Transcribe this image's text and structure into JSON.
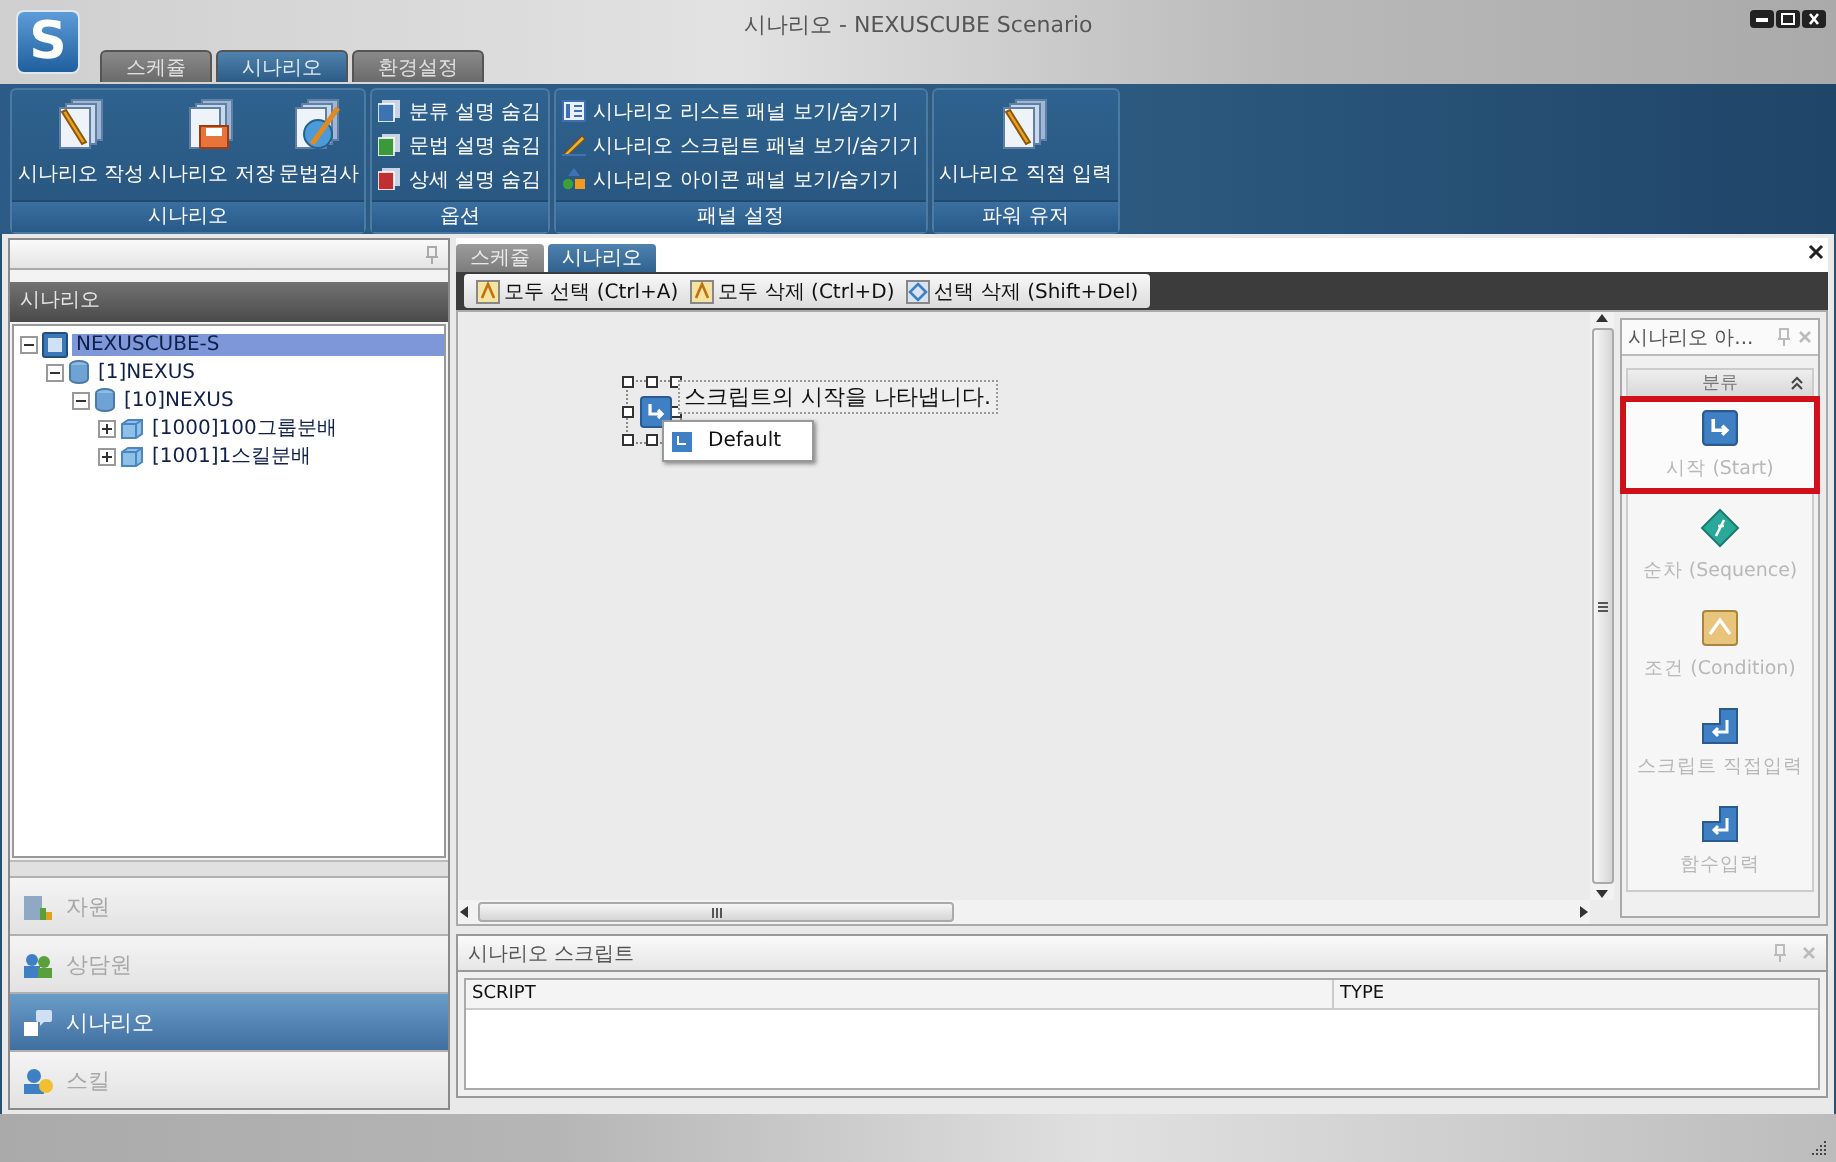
{
  "window": {
    "logo": "S",
    "title": "시나리오 - NEXUSCUBE Scenario"
  },
  "app_tabs": [
    {
      "label": "스케쥴",
      "selected": false
    },
    {
      "label": "시나리오",
      "selected": true
    },
    {
      "label": "환경설정",
      "selected": false
    }
  ],
  "ribbon": {
    "groups": [
      {
        "title": "시나리오",
        "kind": "large",
        "items": [
          "시나리오 작성",
          "시나리오 저장",
          "문법검사"
        ]
      },
      {
        "title": "옵션",
        "kind": "small",
        "items": [
          "분류 설명 숨김",
          "문법 설명 숨김",
          "상세 설명 숨김"
        ]
      },
      {
        "title": "패널 설정",
        "kind": "small",
        "items": [
          "시나리오 리스트 패널 보기/숨기기",
          "시나리오 스크립트 패널 보기/숨기기",
          "시나리오 아이콘 패널 보기/숨기기"
        ]
      },
      {
        "title": "파워 유저",
        "kind": "large",
        "items": [
          "시나리오 직접 입력"
        ]
      }
    ]
  },
  "sidebar": {
    "title": "시나리오",
    "tree": [
      {
        "label": "NEXUSCUBE-S",
        "selected": true,
        "expanded": true,
        "children": [
          {
            "label": "[1]NEXUS",
            "selected": false,
            "expanded": true,
            "children": [
              {
                "label": "[10]NEXUS",
                "selected": false,
                "expanded": true,
                "children": [
                  {
                    "label": "[1000]100그룹분배",
                    "selected": false,
                    "expanded": false
                  },
                  {
                    "label": "[1001]1스킬분배",
                    "selected": false,
                    "expanded": false
                  }
                ]
              }
            ]
          }
        ]
      }
    ],
    "nav": [
      {
        "label": "자원",
        "selected": false
      },
      {
        "label": "상담원",
        "selected": false
      },
      {
        "label": "시나리오",
        "selected": true
      },
      {
        "label": "스킬",
        "selected": false
      }
    ]
  },
  "doc_tabs": [
    {
      "label": "스케쥴",
      "selected": false
    },
    {
      "label": "시나리오",
      "selected": true
    }
  ],
  "toolbar": [
    "모두 선택 (Ctrl+A)",
    "모두 삭제 (Ctrl+D)",
    "선택 삭제 (Shift+Del)"
  ],
  "canvas": {
    "node_label": "스크립트의 시작을 나타냅니다.",
    "menu": [
      "Default"
    ]
  },
  "icon_panel": {
    "title": "시나리오 아...",
    "group": "분류",
    "items": [
      {
        "label": "시작 (Start)",
        "highlighted": true
      },
      {
        "label": "순차 (Sequence)",
        "highlighted": false
      },
      {
        "label": "조건 (Condition)",
        "highlighted": false
      },
      {
        "label": "스크립트 직접입력",
        "highlighted": false
      },
      {
        "label": "함수입력",
        "highlighted": false
      }
    ]
  },
  "script_panel": {
    "title": "시나리오 스크립트",
    "columns": [
      "SCRIPT",
      "TYPE"
    ]
  }
}
